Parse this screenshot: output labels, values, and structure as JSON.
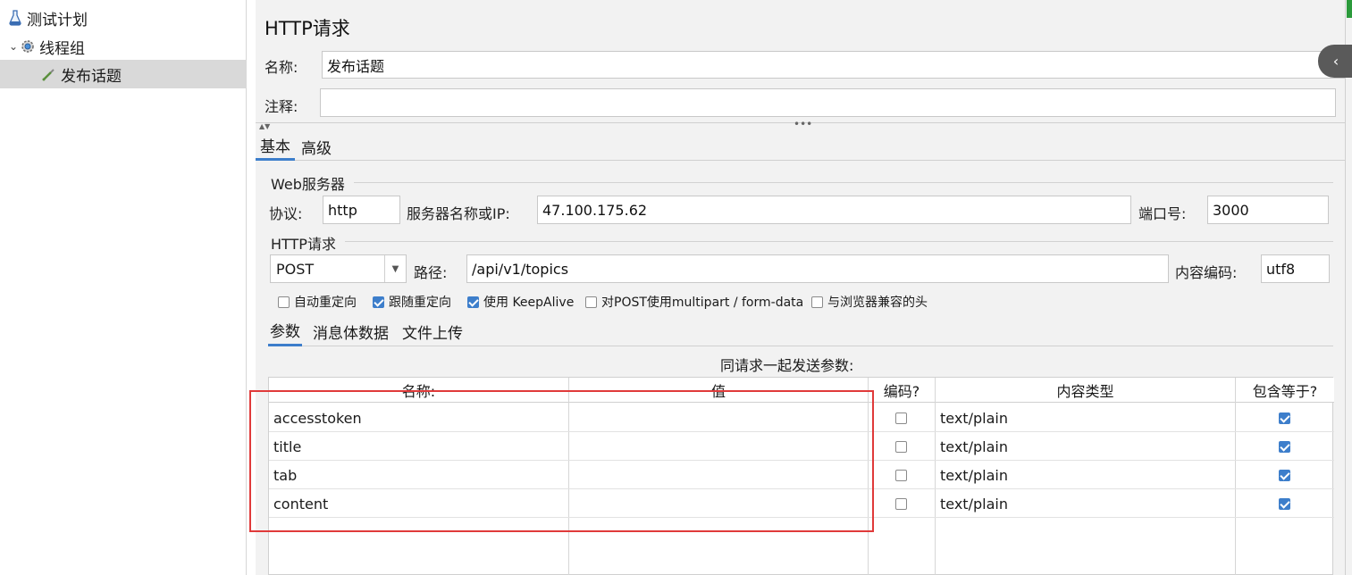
{
  "tree": {
    "items": [
      {
        "label": "测试计划"
      },
      {
        "label": "线程组"
      },
      {
        "label": "发布话题"
      }
    ]
  },
  "sampler": {
    "title": "HTTP请求",
    "name_label": "名称:",
    "name_value": "发布话题",
    "comment_label": "注释:",
    "comment_value": ""
  },
  "tabs": [
    "基本",
    "高级"
  ],
  "web_server": {
    "section": "Web服务器",
    "protocol_label": "协议:",
    "protocol_value": "http",
    "server_label": "服务器名称或IP:",
    "server_value": "47.100.175.62",
    "port_label": "端口号:",
    "port_value": "3000"
  },
  "http_request": {
    "section": "HTTP请求",
    "method_value": "POST",
    "path_label": "路径:",
    "path_value": "/api/v1/topics",
    "encoding_label": "内容编码:",
    "encoding_value": "utf8"
  },
  "options": [
    {
      "label": "自动重定向",
      "checked": false
    },
    {
      "label": "跟随重定向",
      "checked": true
    },
    {
      "label": "使用 KeepAlive",
      "checked": true
    },
    {
      "label": "对POST使用multipart / form-data",
      "checked": false
    },
    {
      "label": "与浏览器兼容的头",
      "checked": false
    }
  ],
  "subtabs": [
    "参数",
    "消息体数据",
    "文件上传"
  ],
  "params": {
    "caption": "同请求一起发送参数:",
    "headers": [
      "名称:",
      "值",
      "编码?",
      "内容类型",
      "包含等于?"
    ],
    "rows": [
      {
        "name": "accesstoken",
        "value": "",
        "encode": false,
        "content_type": "text/plain",
        "include_equals": true
      },
      {
        "name": "title",
        "value": "",
        "encode": false,
        "content_type": "text/plain",
        "include_equals": true
      },
      {
        "name": "tab",
        "value": "",
        "encode": false,
        "content_type": "text/plain",
        "include_equals": true
      },
      {
        "name": "content",
        "value": "",
        "encode": false,
        "content_type": "text/plain",
        "include_equals": true
      }
    ]
  },
  "colors": {
    "accent": "#3d7ecb",
    "highlight_box": "#e03a3a",
    "selected_row": "#d9d9d9"
  }
}
